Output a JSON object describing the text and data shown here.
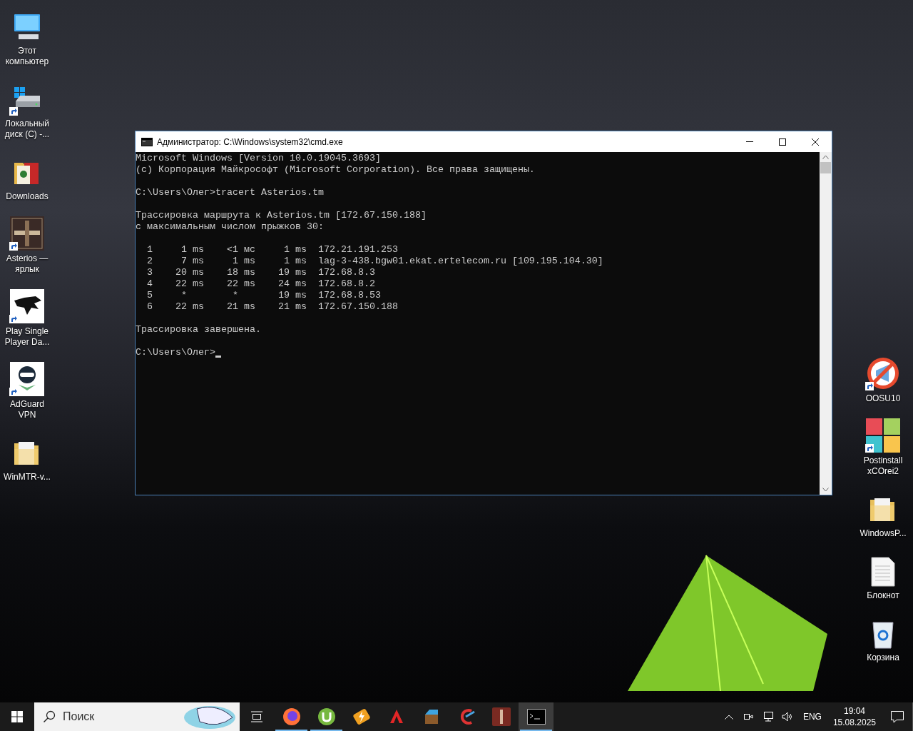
{
  "desktop": {
    "left_icons": [
      {
        "label": "Этот\nкомпьютер",
        "kind": "computer",
        "shortcut": false
      },
      {
        "label": "Локальный\nдиск (C) -...",
        "kind": "drive",
        "shortcut": true
      },
      {
        "label": "Downloads",
        "kind": "folder-red",
        "shortcut": false
      },
      {
        "label": "Asterios —\nярлык",
        "kind": "game",
        "shortcut": true
      },
      {
        "label": "Play Single\nPlayer Da...",
        "kind": "dragon",
        "shortcut": true
      },
      {
        "label": "AdGuard\nVPN",
        "kind": "vpn",
        "shortcut": true
      },
      {
        "label": "WinMTR-v...",
        "kind": "folder",
        "shortcut": false
      }
    ],
    "right_icons": [
      {
        "label": "OOSU10",
        "kind": "blocked",
        "shortcut": true
      },
      {
        "label": "Postinstall\nxCOrei2",
        "kind": "tiles",
        "shortcut": true
      },
      {
        "label": "WindowsP...",
        "kind": "folder",
        "shortcut": false
      },
      {
        "label": "Блокнот",
        "kind": "document",
        "shortcut": false
      },
      {
        "label": "Корзина",
        "kind": "trash",
        "shortcut": false
      }
    ]
  },
  "window": {
    "title": "Администратор: C:\\Windows\\system32\\cmd.exe",
    "console_blocks": [
      [
        "Microsoft Windows [Version 10.0.19045.3693]",
        "(c) Корпорация Майкрософт (Microsoft Corporation). Все права защищены."
      ],
      [
        "C:\\Users\\Олег>tracert Asterios.tm"
      ],
      [
        "Трассировка маршрута к Asterios.tm [172.67.150.188]",
        "с максимальным числом прыжков 30:"
      ],
      [
        "  1     1 ms    <1 мс     1 ms  172.21.191.253",
        "  2     7 ms     1 ms     1 ms  lag-3-438.bgw01.ekat.ertelecom.ru [109.195.104.30]",
        "  3    20 ms    18 ms    19 ms  172.68.8.3",
        "  4    22 ms    22 ms    24 ms  172.68.8.2",
        "  5     *        *       19 ms  172.68.8.53",
        "  6    22 ms    21 ms    21 ms  172.67.150.188"
      ],
      [
        "Трассировка завершена."
      ]
    ],
    "prompt": "C:\\Users\\Олег>"
  },
  "taskbar": {
    "search": {
      "placeholder": "Поиск"
    },
    "apps": [
      {
        "kind": "firefox",
        "running": true,
        "selected": false
      },
      {
        "kind": "torrent",
        "running": true,
        "selected": false
      },
      {
        "kind": "player",
        "running": false,
        "selected": false
      },
      {
        "kind": "zoom",
        "running": false,
        "selected": false
      },
      {
        "kind": "archiver",
        "running": false,
        "selected": false
      },
      {
        "kind": "cleaner",
        "running": false,
        "selected": false
      },
      {
        "kind": "game",
        "running": false,
        "selected": false
      },
      {
        "kind": "terminal",
        "running": true,
        "selected": true
      }
    ],
    "language": "ENG",
    "time": "19:04",
    "date": "15.08.2025"
  }
}
